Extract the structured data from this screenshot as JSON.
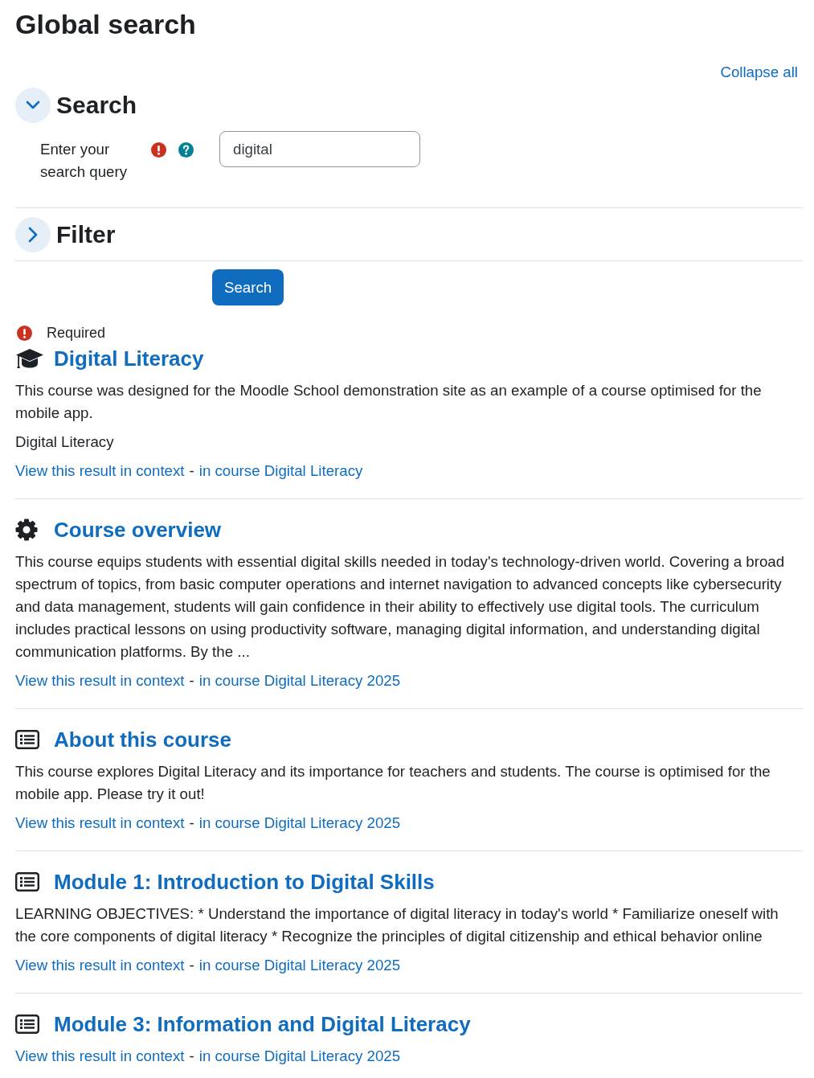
{
  "page": {
    "title": "Global search",
    "collapse_all": "Collapse all"
  },
  "sections": [
    {
      "title": "Search",
      "expanded": true,
      "fields": [
        {
          "label": "Enter your search query",
          "required": true,
          "help": true,
          "value": "digital"
        }
      ]
    },
    {
      "title": "Filter",
      "expanded": false
    }
  ],
  "submit_button": "Search",
  "required_note": "Required",
  "results": [
    {
      "kind": "course",
      "title": "Digital Literacy",
      "description": "This course was designed for the Moodle School demonstration site as an example of a course optimised for the mobile app.",
      "extra": "Digital Literacy",
      "context_link": "View this result in context",
      "separator": "-",
      "course_link": "in course Digital Literacy"
    },
    {
      "kind": "setting",
      "title": "Course overview",
      "description": "This course equips students with essential digital skills needed in today's technology-driven world. Covering a broad spectrum of topics, from basic computer operations and internet navigation to advanced concepts like cybersecurity and data management, students will gain confidence in their ability to effectively use digital tools. The curriculum includes practical lessons on using productivity software, managing digital information, and understanding digital communication platforms. By the ...",
      "context_link": "View this result in context",
      "separator": "-",
      "course_link": "in course Digital Literacy 2025"
    },
    {
      "kind": "page",
      "title": "About this course",
      "description": "This course explores Digital Literacy and its importance for teachers and students. The course is optimised for the mobile app. Please try it out!",
      "context_link": "View this result in context",
      "separator": "-",
      "course_link": "in course Digital Literacy 2025"
    },
    {
      "kind": "page",
      "title": "Module 1: Introduction to Digital Skills",
      "description": "LEARNING OBJECTIVES: * Understand the importance of digital literacy in today's world * Familiarize oneself with the core components of digital literacy * Recognize the principles of digital citizenship and ethical behavior online",
      "context_link": "View this result in context",
      "separator": "-",
      "course_link": "in course Digital Literacy 2025"
    },
    {
      "kind": "page",
      "title": "Module 3: Information and Digital Literacy",
      "context_link": "View this result in context",
      "separator": "-",
      "course_link": "in course Digital Literacy 2025"
    }
  ]
}
